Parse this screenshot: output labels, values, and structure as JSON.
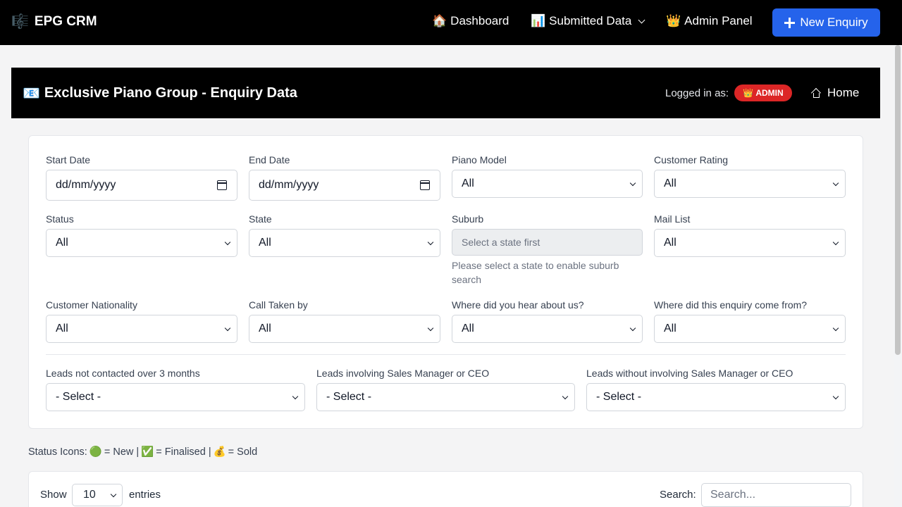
{
  "navbar": {
    "brand_icon": "🎼",
    "brand": "EPG CRM",
    "dashboard_icon": "🏠",
    "dashboard": "Dashboard",
    "submitted_icon": "📊",
    "submitted": "Submitted Data",
    "admin_icon": "👑",
    "admin": "Admin Panel",
    "new_enquiry": "New Enquiry"
  },
  "header": {
    "title_icon": "📧",
    "title": "Exclusive Piano Group - Enquiry Data",
    "logged_in_label": "Logged in as:",
    "badge_icon": "👑",
    "badge": "ADMIN",
    "home": "Home"
  },
  "filters": {
    "start_date": {
      "label": "Start Date",
      "value": "dd/mm/yyyy"
    },
    "end_date": {
      "label": "End Date",
      "value": "dd/mm/yyyy"
    },
    "piano_model": {
      "label": "Piano Model",
      "value": "All"
    },
    "customer_rating": {
      "label": "Customer Rating",
      "value": "All"
    },
    "status": {
      "label": "Status",
      "value": "All"
    },
    "state": {
      "label": "State",
      "value": "All"
    },
    "suburb": {
      "label": "Suburb",
      "placeholder": "Select a state first",
      "help": "Please select a state to enable suburb search"
    },
    "mail_list": {
      "label": "Mail List",
      "value": "All"
    },
    "nationality": {
      "label": "Customer Nationality",
      "value": "All"
    },
    "call_taken": {
      "label": "Call Taken by",
      "value": "All"
    },
    "hear_about": {
      "label": "Where did you hear about us?",
      "value": "All"
    },
    "enquiry_source": {
      "label": "Where did this enquiry come from?",
      "value": "All"
    },
    "not_contacted": {
      "label": "Leads not contacted over 3 months",
      "value": "- Select -"
    },
    "involving_mgr": {
      "label": "Leads involving Sales Manager or CEO",
      "value": "- Select -"
    },
    "without_mgr": {
      "label": "Leads without involving Sales Manager or CEO",
      "value": "- Select -"
    }
  },
  "status_icons": {
    "label": "Status Icons:",
    "new_icon": "🟢",
    "new": "= New |",
    "finalised_icon": "✅",
    "finalised": "= Finalised |",
    "sold_icon": "💰",
    "sold": "= Sold"
  },
  "table": {
    "show": "Show",
    "page_size": "10",
    "entries": "entries",
    "search_label": "Search:",
    "search_placeholder": "Search..."
  },
  "colors": {
    "accent": "#2563eb",
    "badge": "#dc2626",
    "navbar": "#000000"
  }
}
